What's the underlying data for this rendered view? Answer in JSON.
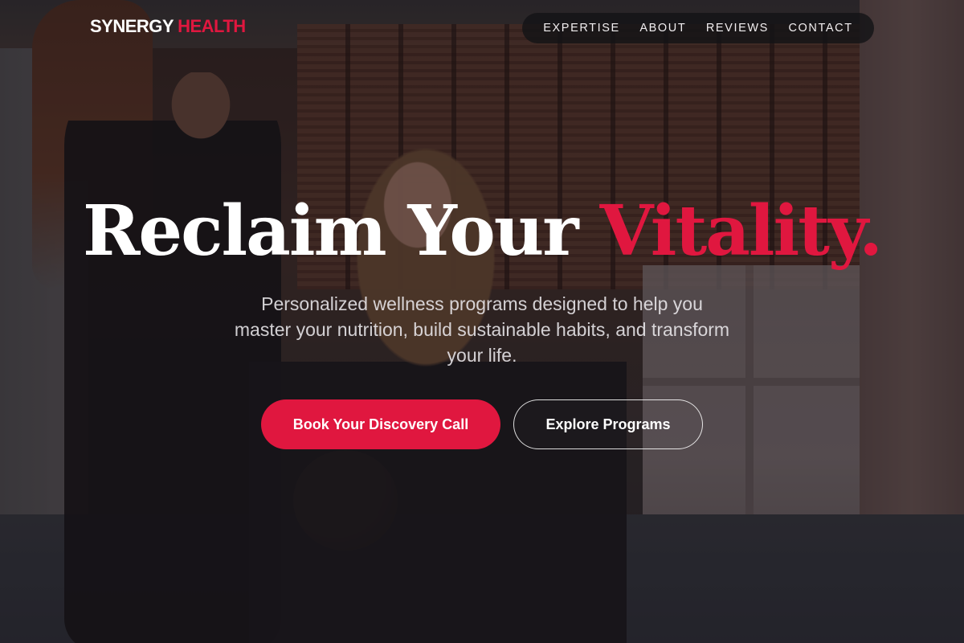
{
  "brand": {
    "name_primary": "SYNERGY",
    "name_accent": "HEALTH"
  },
  "nav": {
    "items": [
      {
        "label": "EXPERTISE"
      },
      {
        "label": "ABOUT"
      },
      {
        "label": "REVIEWS"
      },
      {
        "label": "CONTACT"
      }
    ]
  },
  "hero": {
    "title_main": "Reclaim Your",
    "title_accent": "Vitality.",
    "subtitle": "Personalized wellness programs designed to help you master your nutrition, build sustainable habits, and transform your life.",
    "primary_cta": "Book Your Discovery Call",
    "secondary_cta": "Explore Programs",
    "background_image": "photo of a fitness trainer coaching a woman doing a squat in a gym"
  },
  "colors": {
    "accent": "#e0173f",
    "text": "#ffffff",
    "nav_background": "#141416"
  }
}
